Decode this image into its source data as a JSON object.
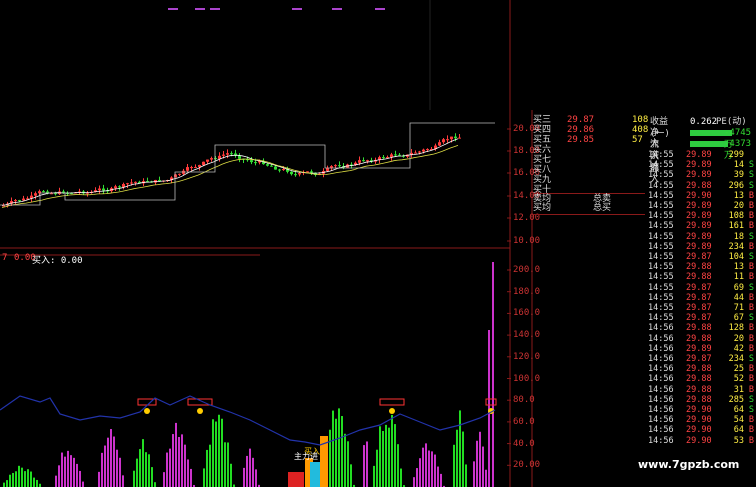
{
  "colors": {
    "up": "#ff3b3b",
    "down": "#33dd33",
    "neutral": "#cccccc",
    "axis": "#8a1a1a",
    "ma": "#ffffff",
    "flowline": "#2233aa",
    "vol_green": "#22dd22",
    "vol_purple": "#cc33cc",
    "vol_orange": "#ff9900",
    "highlight_cyan": "#22bbdd"
  },
  "main_axis": {
    "ticks": [
      "20.00",
      "18.00",
      "16.00",
      "14.00",
      "12.00",
      "10.00"
    ]
  },
  "sub_indicator": {
    "label": "买入: 0.00",
    "left_values": [
      "7",
      "0.00"
    ],
    "annotation_buy": "买入",
    "annotation_main": "主力进"
  },
  "sub_axis": {
    "ticks": [
      "200.0",
      "180.0",
      "160.0",
      "140.0",
      "120.0",
      "100.0",
      "80.0",
      "60.0",
      "40.0",
      "20.00"
    ]
  },
  "order_book": {
    "rows": [
      {
        "label": "买三",
        "price": "29.87",
        "vol": "108"
      },
      {
        "label": "买四",
        "price": "29.86",
        "vol": "408"
      },
      {
        "label": "买五",
        "price": "29.85",
        "vol": "57"
      },
      {
        "label": "买六",
        "price": "",
        "vol": ""
      },
      {
        "label": "买七",
        "price": "",
        "vol": ""
      },
      {
        "label": "买八",
        "price": "",
        "vol": ""
      },
      {
        "label": "买九",
        "price": "",
        "vol": ""
      },
      {
        "label": "买十",
        "price": "",
        "vol": ""
      }
    ],
    "sell_avg_label": "卖均",
    "sell_total_label": "总卖",
    "buy_avg_label": "买均",
    "buy_total_label": "总买"
  },
  "stats": {
    "pe_label": "收益(一)",
    "pe_value": "0.262",
    "pe_suffix": "PE(动)",
    "net_inflow_label": "净流入额",
    "net_inflow_value": "-4745万",
    "big_inflow_label": "大宗流入",
    "big_inflow_value": "-4373万"
  },
  "trades": [
    {
      "time": "14:55",
      "price": "29.89",
      "vol": "299",
      "side": ""
    },
    {
      "time": "14:55",
      "price": "29.89",
      "vol": "14",
      "side": "S"
    },
    {
      "time": "14:55",
      "price": "29.89",
      "vol": "39",
      "side": "S"
    },
    {
      "time": "14:55",
      "price": "29.88",
      "vol": "296",
      "side": "S"
    },
    {
      "time": "14:55",
      "price": "29.90",
      "vol": "13",
      "side": "B"
    },
    {
      "time": "14:55",
      "price": "29.89",
      "vol": "20",
      "side": "B"
    },
    {
      "time": "14:55",
      "price": "29.89",
      "vol": "108",
      "side": "B"
    },
    {
      "time": "14:55",
      "price": "29.89",
      "vol": "161",
      "side": "B"
    },
    {
      "time": "14:55",
      "price": "29.89",
      "vol": "18",
      "side": "S"
    },
    {
      "time": "14:55",
      "price": "29.89",
      "vol": "234",
      "side": "B"
    },
    {
      "time": "14:55",
      "price": "29.87",
      "vol": "104",
      "side": "S"
    },
    {
      "time": "14:55",
      "price": "29.88",
      "vol": "13",
      "side": "B"
    },
    {
      "time": "14:55",
      "price": "29.88",
      "vol": "11",
      "side": "B"
    },
    {
      "time": "14:55",
      "price": "29.87",
      "vol": "69",
      "side": "S"
    },
    {
      "time": "14:55",
      "price": "29.87",
      "vol": "44",
      "side": "B"
    },
    {
      "time": "14:55",
      "price": "29.87",
      "vol": "71",
      "side": "B"
    },
    {
      "time": "14:55",
      "price": "29.87",
      "vol": "67",
      "side": "S"
    },
    {
      "time": "14:56",
      "price": "29.88",
      "vol": "128",
      "side": "B"
    },
    {
      "time": "14:56",
      "price": "29.88",
      "vol": "20",
      "side": "B"
    },
    {
      "time": "14:56",
      "price": "29.89",
      "vol": "42",
      "side": "B"
    },
    {
      "time": "14:56",
      "price": "29.87",
      "vol": "234",
      "side": "S"
    },
    {
      "time": "14:56",
      "price": "29.88",
      "vol": "25",
      "side": "B"
    },
    {
      "time": "14:56",
      "price": "29.88",
      "vol": "52",
      "side": "B"
    },
    {
      "time": "14:56",
      "price": "29.88",
      "vol": "31",
      "side": "B"
    },
    {
      "time": "14:56",
      "price": "29.88",
      "vol": "285",
      "side": "S"
    },
    {
      "time": "14:56",
      "price": "29.90",
      "vol": "64",
      "side": "S"
    },
    {
      "time": "14:56",
      "price": "29.90",
      "vol": "54",
      "side": "B"
    },
    {
      "time": "14:56",
      "price": "29.90",
      "vol": "64",
      "side": "B"
    },
    {
      "time": "14:56",
      "price": "29.90",
      "vol": "53",
      "side": "B"
    }
  ],
  "watermark": "www.7gpzb.com"
}
